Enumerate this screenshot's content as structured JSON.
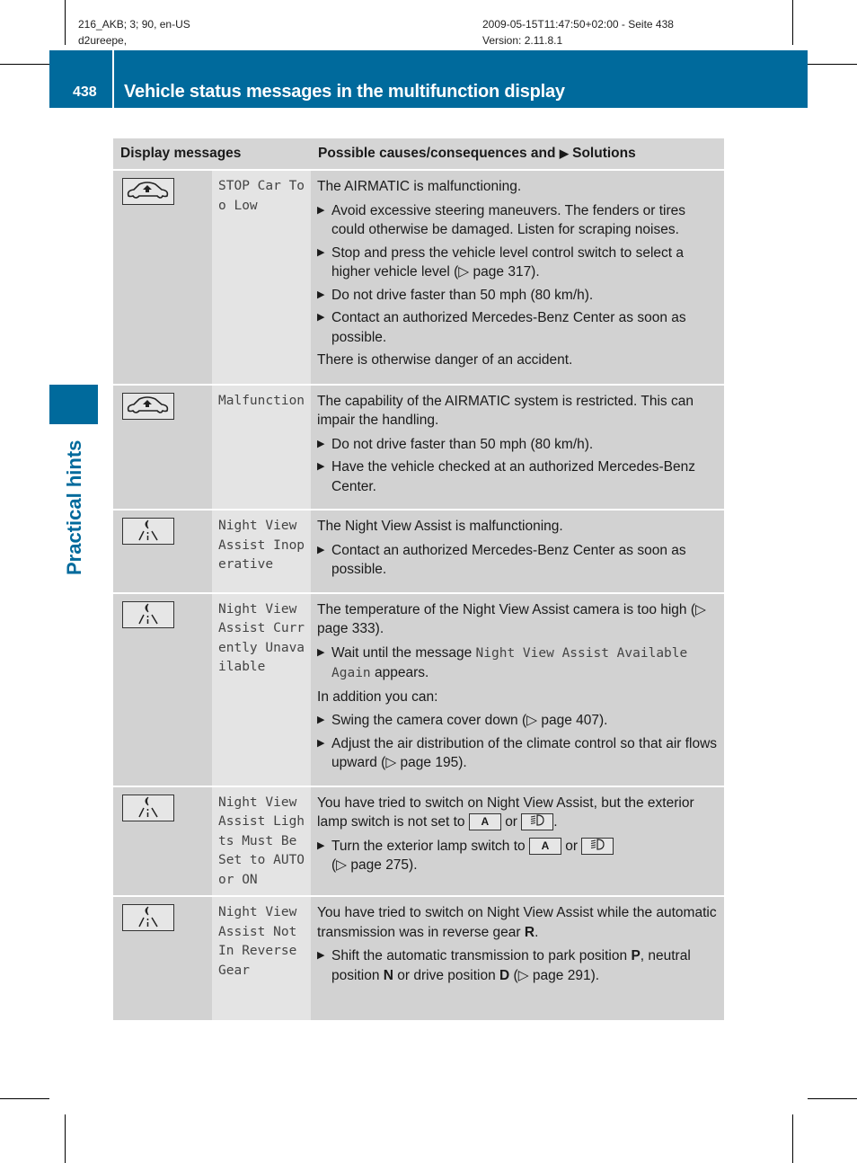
{
  "print_meta": {
    "left_line1": "216_AKB; 3; 90, en-US",
    "left_line2": "d2ureepe,",
    "right_line1": "2009-05-15T11:47:50+02:00 - Seite 438",
    "right_line2": "Version: 2.11.8.1"
  },
  "header": {
    "page_number": "438",
    "title": "Vehicle status messages in the multifunction display"
  },
  "side_label": "Practical hints",
  "table": {
    "col1": "Display messages",
    "col2_prefix": "Possible causes/consequences and",
    "col2_arrow": "▶",
    "col2_suffix": "Solutions",
    "rows": [
      {
        "icon": "airmatic-car-icon",
        "message": "STOP Car Too Low",
        "intro": "The AIRMATIC is malfunctioning.",
        "bullets": [
          "Avoid excessive steering maneuvers. The fenders or tires could otherwise be damaged. Listen for scraping noises.",
          "Stop and press the vehicle level control switch to select a higher vehicle level (▷ page 317).",
          "Do not drive faster than 50 mph (80 km/h).",
          "Contact an authorized Mercedes-Benz Center as soon as possible."
        ],
        "outro": "There is otherwise danger of an accident."
      },
      {
        "icon": "airmatic-car-icon",
        "message": "Malfunction",
        "intro": "The capability of the AIRMATIC system is restricted. This can impair the handling.",
        "bullets": [
          "Do not drive faster than 50 mph (80 km/h).",
          "Have the vehicle checked at an authorized Mercedes-Benz Center."
        ]
      },
      {
        "icon": "night-view-icon",
        "message": "Night View Assist Inoperative",
        "intro": "The Night View Assist is malfunctioning.",
        "bullets": [
          "Contact an authorized Mercedes-Benz Center as soon as possible."
        ]
      },
      {
        "icon": "night-view-icon",
        "message": "Night View Assist Currently Unavailable",
        "intro": "The temperature of the Night View Assist camera is too high (▷ page 333).",
        "bullet_wait_prefix": "Wait until the message",
        "bullet_wait_mono": "Night View Assist Available Again",
        "bullet_wait_suffix": "appears.",
        "middle": "In addition you can:",
        "bullets_after": [
          "Swing the camera cover down (▷ page 407).",
          "Adjust the air distribution of the climate control so that air flows upward (▷ page 195)."
        ]
      },
      {
        "icon": "night-view-icon",
        "message": "Night View Assist Lights Must Be Set to AUTO or ON",
        "intro_prefix": "You have tried to switch on Night View Assist, but the exterior lamp switch is not set to",
        "key_auto": "A",
        "or": "or",
        "bullet_prefix": "Turn the exterior lamp switch to",
        "bullet_suffix": "(▷ page 275)."
      },
      {
        "icon": "night-view-icon",
        "message": "Night View Assist Not In Reverse Gear",
        "intro_prefix": "You have tried to switch on Night View Assist while the automatic transmission was in reverse gear",
        "intro_gear": "R",
        "bullet_p1": "Shift the automatic transmission to park position",
        "gear_p": "P",
        "bullet_p2": ", neutral position",
        "gear_n": "N",
        "bullet_p3": "or drive position",
        "gear_d": "D",
        "bullet_p4": "(▷ page 291)."
      }
    ]
  },
  "colors": {
    "brand_blue": "#006a9c",
    "header_row": "#d5d5d5",
    "icon_col": "#d2d2d2",
    "message_col": "#e4e4e4"
  }
}
